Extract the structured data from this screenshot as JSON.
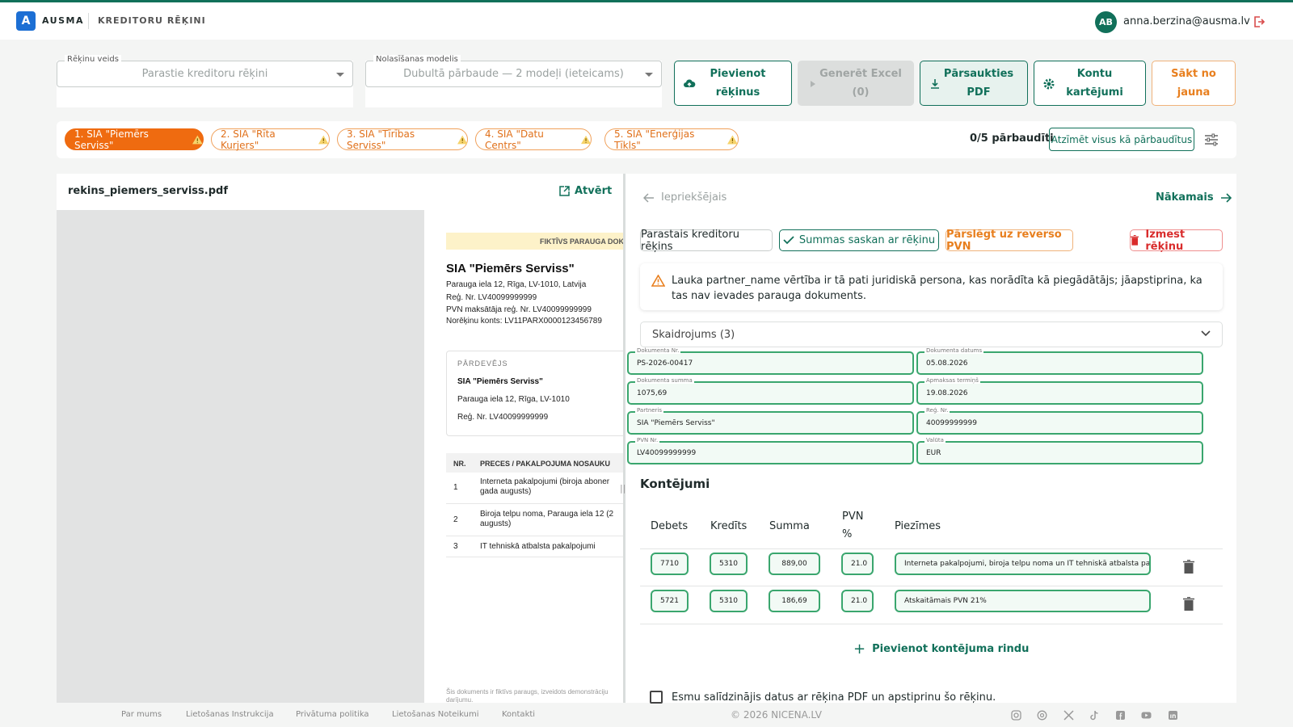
{
  "app": {
    "logo_letter": "A",
    "brand": "AUSMA",
    "section": "KREDITORU RĒĶINI",
    "user_initials": "AB",
    "user_email": "anna.berzina@ausma.lv",
    "accent": "#11705a"
  },
  "toolbar": {
    "invoice_type_label": "Rēķinu veids",
    "invoice_type_value": "Parastie kreditoru rēķini",
    "model_label": "Nolasīšanas modelis",
    "model_value": "Dubultā pārbaude — 2 modeļi (ieteicams)",
    "add_invoices_line1": "Pievienot",
    "add_invoices_line2": "rēķinus",
    "generate_excel_line1": "Generēt Excel",
    "generate_excel_line2": "(0)",
    "download_pdf_line1": "Pārsaukties",
    "download_pdf_line2": "PDF",
    "accounts_line1": "Kontu",
    "accounts_line2": "kartējumi",
    "restart_line1": "Sākt no",
    "restart_line2": "jauna"
  },
  "invoice_tabs": [
    {
      "label": "1. SIA \"Piemērs Serviss\"",
      "active": true
    },
    {
      "label": "2. SIA \"Rīta Kurjers\"",
      "active": false
    },
    {
      "label": "3. SIA \"Tīrības Serviss\"",
      "active": false
    },
    {
      "label": "4. SIA \"Datu Centrs\"",
      "active": false
    },
    {
      "label": "5. SIA \"Enerģijas Tīkls\"",
      "active": false
    }
  ],
  "status": {
    "checked": "0/5 pārbaudīti",
    "mark_all": "Atzīmēt visus kā pārbaudītus"
  },
  "pdf": {
    "filename": "rekins_piemers_serviss.pdf",
    "open_label": "Atvērt",
    "banner": "FIKTĪVS PARAUGA DOK",
    "supplier_name": "SIA \"Piemērs Serviss\"",
    "supplier_lines": [
      "Parauga iela 12, Rīga, LV-1010, Latvija",
      "Reģ. Nr. LV40099999999",
      "PVN maksātāja reģ. Nr. LV40099999999",
      "Norēķinu konts: LV11PARX0000123456789"
    ],
    "seller_title": "PĀRDEVĒJS",
    "seller_name": "SIA \"Piemērs Serviss\"",
    "seller_lines": [
      "Parauga iela 12, Rīga, LV-1010",
      "Reģ. Nr. LV40099999999"
    ],
    "table_headers": [
      "NR.",
      "PRECES / PAKALPOJUMA NOSAUKU"
    ],
    "table_rows": [
      {
        "nr": "1",
        "desc": "Interneta pakalpojumi (biroja aboner gada augusts)"
      },
      {
        "nr": "2",
        "desc": "Biroja telpu noma, Parauga iela 12 (2 augusts)"
      },
      {
        "nr": "3",
        "desc": "IT tehniskā atbalsta pakalpojumi"
      }
    ],
    "footnote": "Šis dokuments ir fiktīvs paraugs, izveidots demonstrāciju darījumu."
  },
  "detail": {
    "prev_label": "Iepriekšējais",
    "next_label": "Nākamais",
    "chip_type": "Parastais kreditoru rēķins",
    "chip_sums": "Summas saskan ar rēķinu",
    "chip_reverse": "Pārslēgt uz reverso PVN",
    "chip_delete": "Izmest rēķinu",
    "warning": "Lauka partner_name vērtība ir tā pati juridiskā persona, kas norādīta kā piegādātājs; jāapstiprina, ka tas nav ievades parauga dokuments.",
    "explanation": "Skaidrojums (3)",
    "fields": [
      {
        "label": "Dokumenta Nr.",
        "value": "PS-2026-00417"
      },
      {
        "label": "Dokumenta datums",
        "value": "05.08.2026"
      },
      {
        "label": "Dokumenta summa",
        "value": "1075,69"
      },
      {
        "label": "Apmaksas termiņš",
        "value": "19.08.2026"
      },
      {
        "label": "Partneris",
        "value": "SIA \"Piemērs Serviss\""
      },
      {
        "label": "Reģ. Nr.",
        "value": "40099999999"
      },
      {
        "label": "PVN Nr.",
        "value": "LV40099999999"
      },
      {
        "label": "Valūta",
        "value": "EUR"
      }
    ],
    "postings_title": "Kontējumi",
    "postings_headers": {
      "debit": "Debets",
      "credit": "Kredīts",
      "sum": "Summa",
      "vat_line1": "PVN",
      "vat_line2": "%",
      "notes": "Piezīmes"
    },
    "postings": [
      {
        "debit": "7710",
        "credit": "5310",
        "sum": "889,00",
        "vat": "21.0",
        "notes": "Interneta pakalpojumi, biroja telpu noma un IT tehniskā atbalsta pakalpojumi"
      },
      {
        "debit": "5721",
        "credit": "5310",
        "sum": "186,69",
        "vat": "21.0",
        "notes": "Atskaitāmais PVN 21%"
      }
    ],
    "add_row_label": "Pievienot kontējuma rindu",
    "confirm_label": "Esmu salīdzinājis datus ar rēķina PDF un apstiprinu šo rēķinu."
  },
  "footer": {
    "links": [
      "Par mums",
      "Lietošanas Instrukcija",
      "Privātuma politika",
      "Lietošanas Noteikumi",
      "Kontakti"
    ],
    "copyright": "© 2026 NICENA.LV",
    "social_icons": [
      "instagram-icon",
      "threads-icon",
      "x-icon",
      "tiktok-icon",
      "facebook-icon",
      "youtube-icon",
      "linkedin-icon"
    ]
  }
}
